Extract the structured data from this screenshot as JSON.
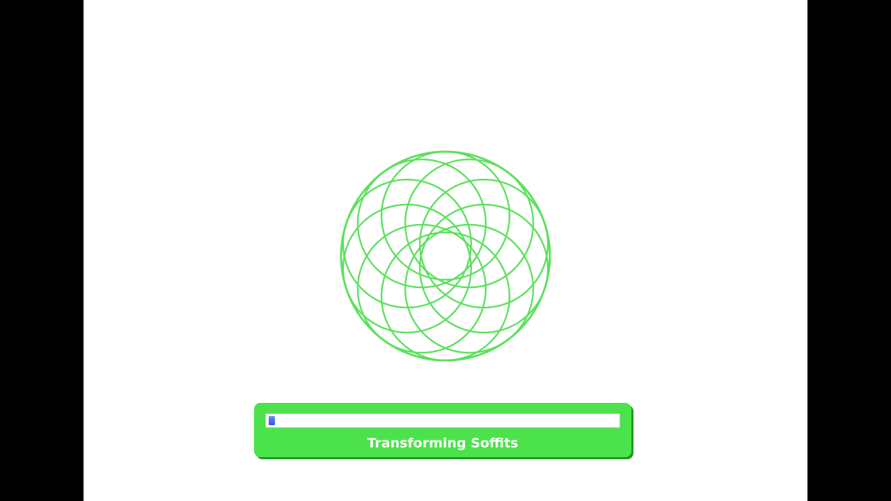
{
  "loader": {
    "status_text": "Transforming Soffits",
    "progress": 0.018
  },
  "spirograph": {
    "icon": "spirograph-loading-icon",
    "petals": 10,
    "color": "#5ee05e"
  },
  "colors": {
    "panel": "#4ce24c",
    "panel_shadow": "#1e9a1e",
    "progress_fill": "#3a63e6",
    "letterbox": "#000000",
    "stage": "#ffffff"
  }
}
